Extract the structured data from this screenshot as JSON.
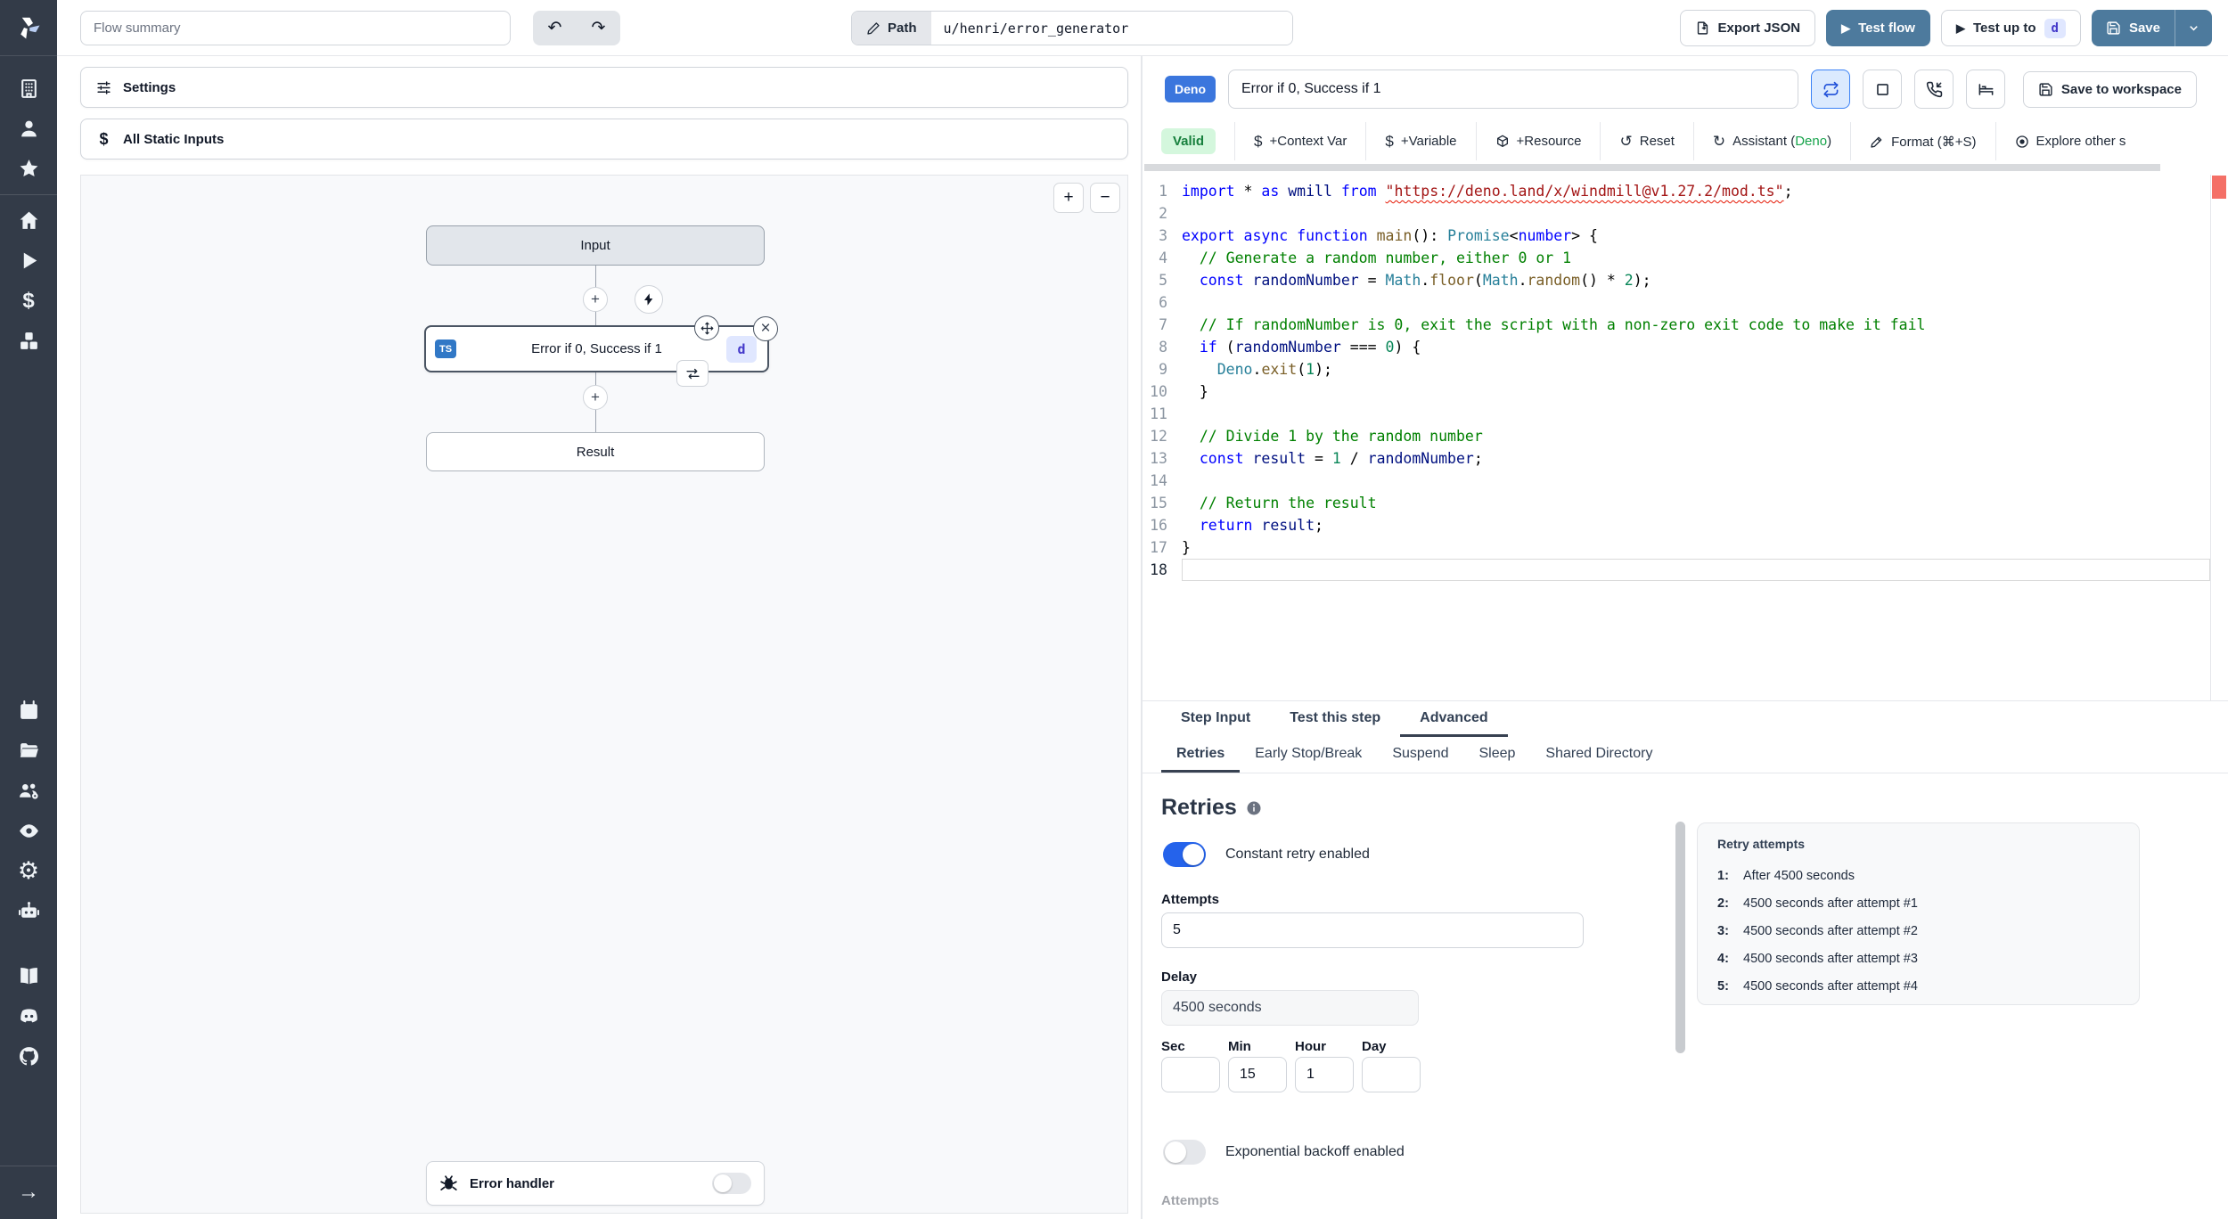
{
  "header": {
    "flow_summary_placeholder": "Flow summary",
    "undo": "↶",
    "redo": "↷",
    "path_label": "Path",
    "path_value": "u/henri/error_generator",
    "export_json": "Export JSON",
    "test_flow": "Test flow",
    "test_up_to": "Test up to",
    "test_up_to_step": "d",
    "save": "Save"
  },
  "sidebar": {
    "icons": [
      "windmill-logo",
      "workspace-building",
      "user",
      "favorites-star",
      "home",
      "runs-play",
      "variables-dollar",
      "resources-cubes",
      "schedules-calendar",
      "folders",
      "groups-gear",
      "audit-eye",
      "settings-gear",
      "workers-robot",
      "docs-book",
      "discord",
      "github",
      "collapse-arrow"
    ],
    "dollar_glyph": "$",
    "gear_glyph": "⚙",
    "arrow_glyph": "→"
  },
  "flow_panel": {
    "settings": "Settings",
    "all_static_inputs": "All Static Inputs",
    "zoom_in": "+",
    "zoom_out": "−",
    "plus": "+",
    "close": "×",
    "nodes": {
      "input": "Input",
      "step_label": "Error if 0, Success if 1",
      "step_lang_badge": "TS",
      "step_id_badge": "d",
      "result": "Result"
    },
    "error_handler": "Error handler"
  },
  "step_panel": {
    "lang_badge": "Deno",
    "step_name": "Error if 0, Success if 1",
    "save_to_workspace": "Save to workspace",
    "toolbar": {
      "valid": "Valid",
      "context_var": "+Context Var",
      "variable": "+Variable",
      "resource": "+Resource",
      "reset": "Reset",
      "reset_glyph": "↺",
      "assistant_glyph": "↻",
      "assistant_prefix": "Assistant (",
      "assistant_lang": "Deno",
      "assistant_suffix": ")",
      "format": "Format (⌘+S)",
      "explore": "Explore other s",
      "dollar": "$"
    }
  },
  "editor": {
    "active_line": 18,
    "lines": [
      [
        [
          "kw",
          "import"
        ],
        [
          "pl",
          " * "
        ],
        [
          "kw",
          "as"
        ],
        [
          "pl",
          " "
        ],
        [
          "var",
          "wmill"
        ],
        [
          "pl",
          " "
        ],
        [
          "kw",
          "from"
        ],
        [
          "pl",
          " "
        ],
        [
          "strsq",
          "\"https://deno.land/x/windmill@v1.27.2/mod.ts\""
        ],
        [
          "pl",
          ";"
        ]
      ],
      [],
      [
        [
          "kw",
          "export"
        ],
        [
          "pl",
          " "
        ],
        [
          "kw",
          "async"
        ],
        [
          "pl",
          " "
        ],
        [
          "kw",
          "function"
        ],
        [
          "pl",
          " "
        ],
        [
          "fn",
          "main"
        ],
        [
          "pl",
          "(): "
        ],
        [
          "cls",
          "Promise"
        ],
        [
          "pl",
          "<"
        ],
        [
          "kw",
          "number"
        ],
        [
          "pl",
          "> {"
        ]
      ],
      [
        [
          "cmt",
          "  // Generate a random number, either 0 or 1"
        ]
      ],
      [
        [
          "pl",
          "  "
        ],
        [
          "kw",
          "const"
        ],
        [
          "pl",
          " "
        ],
        [
          "var",
          "randomNumber"
        ],
        [
          "pl",
          " = "
        ],
        [
          "cls",
          "Math"
        ],
        [
          "pl",
          "."
        ],
        [
          "fn",
          "floor"
        ],
        [
          "pl",
          "("
        ],
        [
          "cls",
          "Math"
        ],
        [
          "pl",
          "."
        ],
        [
          "fn",
          "random"
        ],
        [
          "pl",
          "() * "
        ],
        [
          "num",
          "2"
        ],
        [
          "pl",
          ");"
        ]
      ],
      [],
      [
        [
          "cmt",
          "  // If randomNumber is 0, exit the script with a non-zero exit code to make it fail"
        ]
      ],
      [
        [
          "pl",
          "  "
        ],
        [
          "kw",
          "if"
        ],
        [
          "pl",
          " ("
        ],
        [
          "var",
          "randomNumber"
        ],
        [
          "pl",
          " === "
        ],
        [
          "num",
          "0"
        ],
        [
          "pl",
          ") {"
        ]
      ],
      [
        [
          "pl",
          "    "
        ],
        [
          "cls",
          "Deno"
        ],
        [
          "pl",
          "."
        ],
        [
          "fn",
          "exit"
        ],
        [
          "pl",
          "("
        ],
        [
          "num",
          "1"
        ],
        [
          "pl",
          ");"
        ]
      ],
      [
        [
          "pl",
          "  }"
        ]
      ],
      [],
      [
        [
          "cmt",
          "  // Divide 1 by the random number"
        ]
      ],
      [
        [
          "pl",
          "  "
        ],
        [
          "kw",
          "const"
        ],
        [
          "pl",
          " "
        ],
        [
          "var",
          "result"
        ],
        [
          "pl",
          " = "
        ],
        [
          "num",
          "1"
        ],
        [
          "pl",
          " / "
        ],
        [
          "var",
          "randomNumber"
        ],
        [
          "pl",
          ";"
        ]
      ],
      [],
      [
        [
          "cmt",
          "  // Return the result"
        ]
      ],
      [
        [
          "pl",
          "  "
        ],
        [
          "kw",
          "return"
        ],
        [
          "pl",
          " "
        ],
        [
          "var",
          "result"
        ],
        [
          "pl",
          ";"
        ]
      ],
      [
        [
          "pl",
          "}"
        ]
      ],
      []
    ]
  },
  "tabs": {
    "main": [
      "Step Input",
      "Test this step",
      "Advanced"
    ],
    "active_main": "Advanced",
    "sub": [
      "Retries",
      "Early Stop/Break",
      "Suspend",
      "Sleep",
      "Shared Directory"
    ],
    "active_sub": "Retries"
  },
  "retries": {
    "title": "Retries",
    "constant_toggle_label": "Constant retry enabled",
    "constant_enabled": true,
    "attempts_label": "Attempts",
    "attempts_value": "5",
    "delay_label": "Delay",
    "delay_value": "4500 seconds",
    "time_fields": [
      {
        "label": "Sec",
        "value": ""
      },
      {
        "label": "Min",
        "value": "15"
      },
      {
        "label": "Hour",
        "value": "1"
      },
      {
        "label": "Day",
        "value": ""
      }
    ],
    "exponential_toggle_label": "Exponential backoff enabled",
    "exponential_enabled": false,
    "attempts_cut_label": "Attempts",
    "preview": {
      "title": "Retry attempts",
      "items": [
        {
          "n": "1:",
          "text": "After 4500 seconds"
        },
        {
          "n": "2:",
          "text": "4500 seconds after attempt #1"
        },
        {
          "n": "3:",
          "text": "4500 seconds after attempt #2"
        },
        {
          "n": "4:",
          "text": "4500 seconds after attempt #3"
        },
        {
          "n": "5:",
          "text": "4500 seconds after attempt #4"
        }
      ]
    }
  }
}
